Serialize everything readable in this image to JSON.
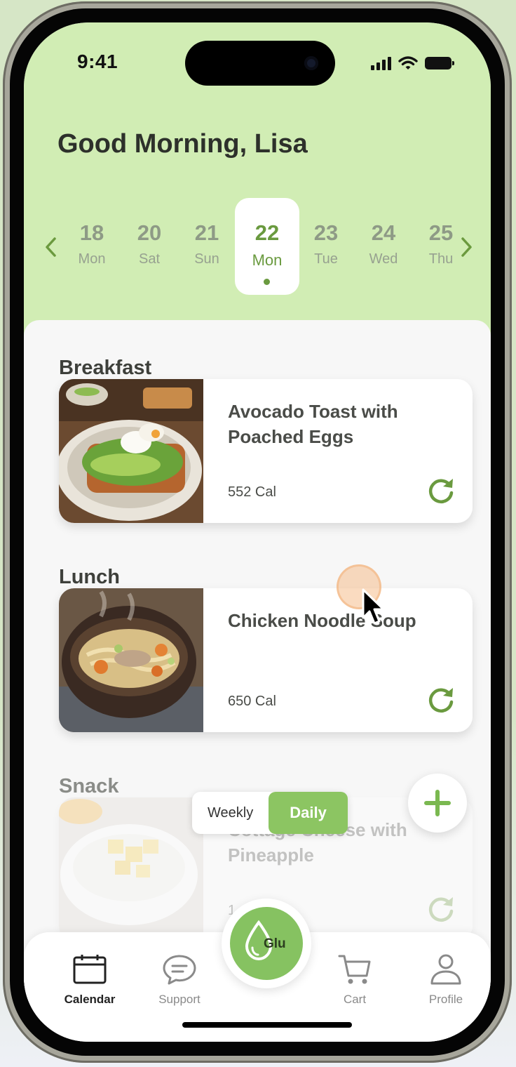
{
  "status_bar": {
    "time": "9:41"
  },
  "header": {
    "greeting": "Good Morning, Lisa"
  },
  "dates": [
    {
      "day": "18",
      "weekday": "Mon"
    },
    {
      "day": "20",
      "weekday": "Sat"
    },
    {
      "day": "21",
      "weekday": "Sun"
    },
    {
      "day": "22",
      "weekday": "Mon",
      "selected": true
    },
    {
      "day": "23",
      "weekday": "Tue"
    },
    {
      "day": "24",
      "weekday": "Wed"
    },
    {
      "day": "25",
      "weekday": "Thu"
    }
  ],
  "meals": [
    {
      "section": "Breakfast",
      "name": "Avocado Toast with Poached Eggs",
      "calories": "552 Cal"
    },
    {
      "section": "Lunch",
      "name": "Chicken Noodle Soup",
      "calories": "650 Cal"
    },
    {
      "section": "Snack",
      "name": "Cottage Cheese with Pineapple",
      "calories": "1"
    }
  ],
  "view_toggle": {
    "weekly": "Weekly",
    "daily": "Daily",
    "selected": "Daily"
  },
  "tabbar": {
    "calendar": "Calendar",
    "support": "Support",
    "glu": "Glu",
    "cart": "Cart",
    "profile": "Profile",
    "active": "Calendar"
  },
  "colors": {
    "accent": "#86c261",
    "hero_bg": "#d1edb4",
    "date_selected": "#6a9a3f"
  },
  "icons": [
    "chevron-left-icon",
    "chevron-right-icon",
    "refresh-icon",
    "plus-icon",
    "calendar-icon",
    "chat-icon",
    "drop-icon",
    "cart-icon",
    "user-icon"
  ]
}
